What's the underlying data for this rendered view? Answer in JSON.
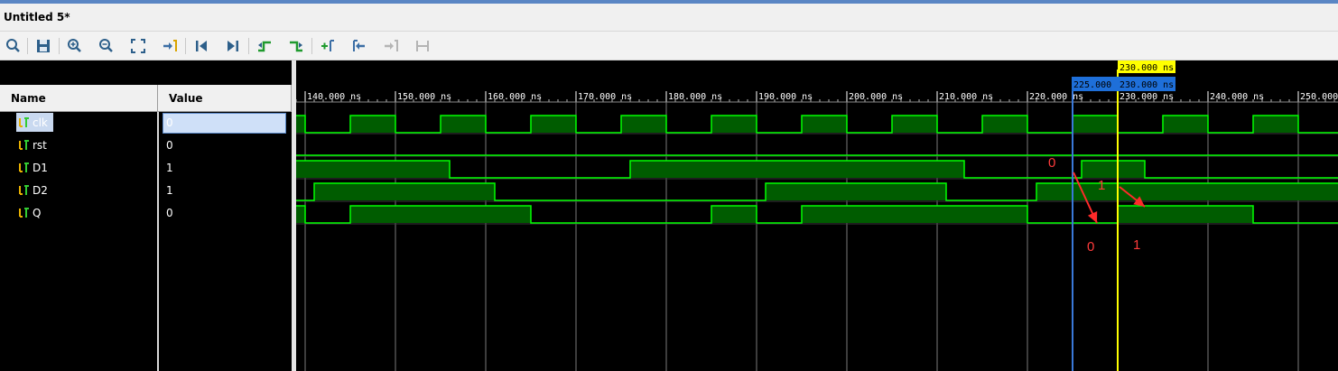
{
  "window": {
    "title": "Untitled 5*"
  },
  "toolbar": {
    "buttons": [
      {
        "name": "search-icon"
      },
      {
        "name": "save-icon"
      },
      {
        "name": "zoom-in-icon"
      },
      {
        "name": "zoom-out-icon"
      },
      {
        "name": "zoom-fit-icon"
      },
      {
        "name": "go-to-cursor-icon"
      },
      {
        "name": "go-to-time-zero-icon"
      },
      {
        "name": "go-to-last-time-icon"
      },
      {
        "name": "previous-transition-icon"
      },
      {
        "name": "next-transition-icon"
      },
      {
        "name": "add-marker-icon"
      },
      {
        "name": "previous-marker-icon"
      },
      {
        "name": "next-marker-icon"
      },
      {
        "name": "swap-cursors-icon"
      }
    ]
  },
  "columns": {
    "name": "Name",
    "value": "Value"
  },
  "signals": [
    {
      "name": "clk",
      "value": "0"
    },
    {
      "name": "rst",
      "value": "0"
    },
    {
      "name": "D1",
      "value": "1"
    },
    {
      "name": "D2",
      "value": "1"
    },
    {
      "name": "Q",
      "value": "0"
    }
  ],
  "timeline": {
    "ticks": [
      "140.000 ns",
      "150.000 ns",
      "160.000 ns",
      "170.000 ns",
      "180.000 ns",
      "190.000 ns",
      "200.000 ns",
      "210.000 ns",
      "220.000 ns",
      "230.000 ns",
      "240.000 ns",
      "250.000 ns"
    ],
    "tick_values_ns": [
      140,
      150,
      160,
      170,
      180,
      190,
      200,
      210,
      220,
      230,
      240,
      250
    ],
    "view_range_ns": [
      139.0,
      254.4
    ]
  },
  "cursors": {
    "main": {
      "time_ns": 230,
      "label": "230.000 ns",
      "color": "#ffff00"
    },
    "secondary": {
      "time_ns": 225,
      "label": "225.000",
      "color": "#3a78d8"
    },
    "secondary_readout": "230.000 ns"
  },
  "waveforms": {
    "clk": {
      "initial": 1,
      "transitions_ns": [
        140,
        145,
        150,
        155,
        160,
        165,
        170,
        175,
        180,
        185,
        190,
        195,
        200,
        205,
        210,
        215,
        220,
        225,
        230,
        235,
        240,
        245,
        250
      ]
    },
    "rst": {
      "initial": 0,
      "transitions_ns": []
    },
    "D1": {
      "initial": 1,
      "transitions_ns": [
        156,
        176,
        213,
        226,
        233
      ]
    },
    "D2": {
      "initial": 0,
      "transitions_ns": [
        141,
        161,
        191,
        211,
        221
      ]
    },
    "Q": {
      "initial": 1,
      "transitions_ns": [
        140,
        145,
        165,
        185,
        190,
        195,
        220,
        230,
        245
      ]
    }
  },
  "annotations": [
    "0",
    "1",
    "0",
    "1"
  ],
  "colors": {
    "wave": "#00ff00",
    "wave_fill": "#005c00",
    "grid": "#7a7a7a"
  }
}
